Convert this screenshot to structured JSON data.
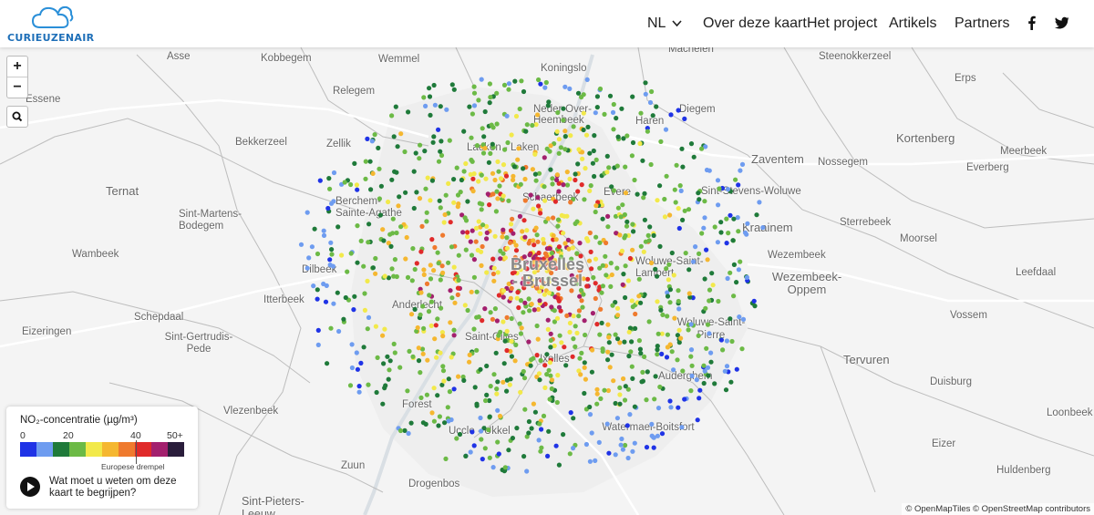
{
  "brand": {
    "logo_text": "CURIEUZENAIR"
  },
  "nav": {
    "language": "NL",
    "items": [
      "Over deze kaart",
      "Het project",
      "Artikels",
      "Partners"
    ],
    "social": [
      "facebook-icon",
      "twitter-icon"
    ]
  },
  "map": {
    "zoom_in": "+",
    "zoom_out": "−",
    "city_label": "Bruxelles - Brussel",
    "city_label_line1": "Bruxelles",
    "city_label_line2": "- Brussel",
    "places": [
      "Asse",
      "Kobbegem",
      "Wemmel",
      "Koningslo",
      "Machelen",
      "Steenokkerzeel",
      "Erps",
      "Essene",
      "Relegem",
      "Neder-Over-Heembeek",
      "Haren",
      "Diegem",
      "Bekkerzeel",
      "Zellik",
      "Laeken - Laken",
      "Kortenberg",
      "Zaventem",
      "Nossegem",
      "Meerbeek",
      "Everberg",
      "Ternat",
      "Berchem-Sainte-Agathe",
      "Schaerbeek",
      "Evere",
      "Sint-Stevens-Woluwe",
      "Sint-Martens-Bodegem",
      "Kraainem",
      "Sterrebeek",
      "Wambeek",
      "Wezembeek",
      "Moorsel",
      "Dilbeek",
      "Woluwe-Saint-Lambert",
      "Wezembeek-Oppem",
      "Leefdaal",
      "Itterbeek",
      "Anderlecht",
      "Schepdaal",
      "Vossem",
      "Eizeringen",
      "Sint-Gertrudis-Pede",
      "Woluwe-Saint-Pierre",
      "Tervuren",
      "Saint-Gilles",
      "Ixelles",
      "Duisburg",
      "Auderghem",
      "Vlezenbeek",
      "Forest",
      "Loonbeek",
      "Uccle - Ukkel",
      "Watermael-Boitsfort",
      "Eizer",
      "Zuun",
      "Hulden­berg",
      "Drogenbos",
      "Sint-Pieters-Leeuw"
    ],
    "attribution": "© OpenMapTiles © OpenStreetMap contributors"
  },
  "legend": {
    "title": "NO₂-concentratie (µg/m³)",
    "ticks": [
      "0",
      "20",
      "40",
      "50+"
    ],
    "colors": [
      "#1f33e6",
      "#6e9cf0",
      "#1f7a3a",
      "#6cba46",
      "#f2e94a",
      "#f5b730",
      "#ef7a2e",
      "#e02a2a",
      "#a3206e",
      "#2a1d3b"
    ],
    "threshold_label": "Europese drempel",
    "help_text": "Wat moet u weten om deze kaart te begrijpen?"
  }
}
